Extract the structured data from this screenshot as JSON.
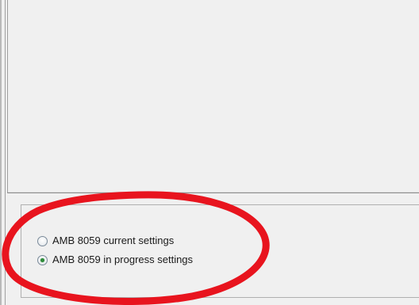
{
  "options": {
    "items": [
      {
        "label": "AMB 8059 current settings",
        "checked": false
      },
      {
        "label": "AMB 8059 in progress settings",
        "checked": true
      }
    ]
  },
  "colors": {
    "window_bg": "#f0f0f0",
    "annotation_stroke": "#e8141e",
    "radio_selected": "#2e8b3a"
  }
}
